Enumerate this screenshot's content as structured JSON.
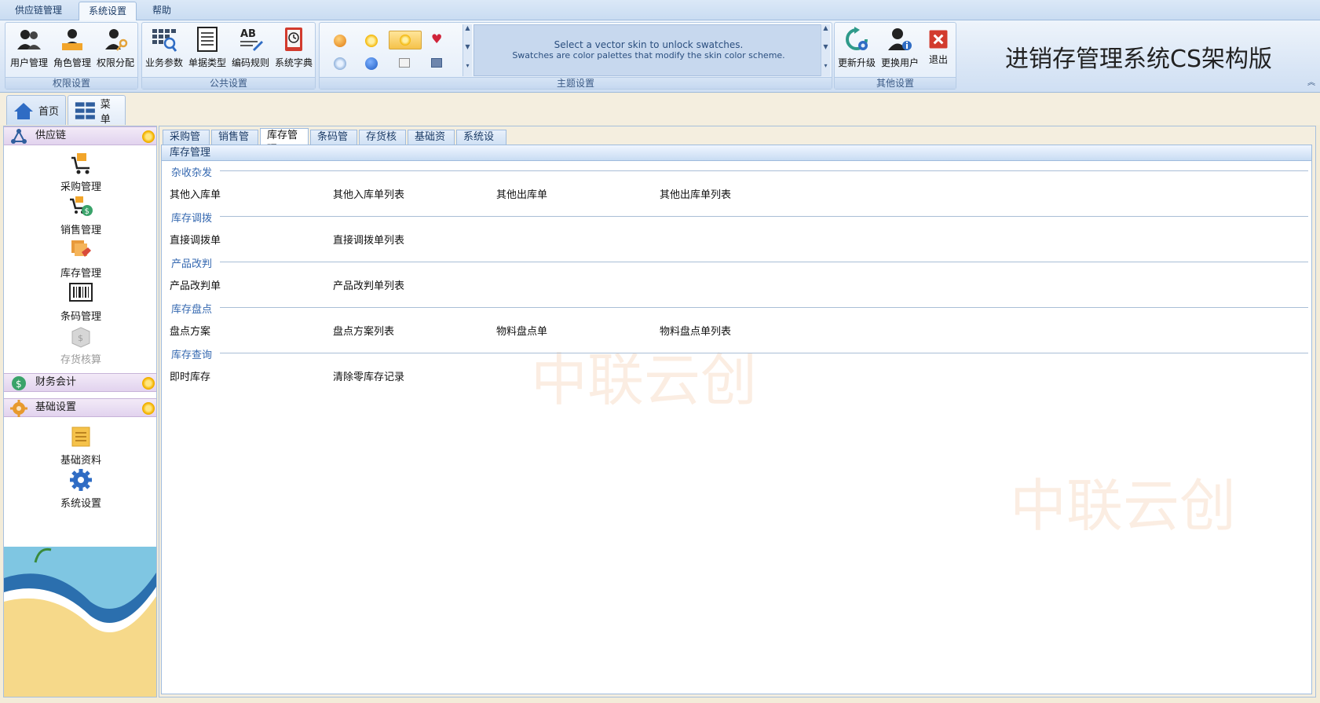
{
  "ribbon_tabs": [
    "供应链管理",
    "系统设置",
    "帮助"
  ],
  "active_ribbon_tab": "系统设置",
  "groups": {
    "permission": {
      "label": "权限设置",
      "buttons": [
        "用户管理",
        "角色管理",
        "权限分配"
      ]
    },
    "public": {
      "label": "公共设置",
      "buttons": [
        "业务参数",
        "单据类型",
        "编码规则",
        "系统字典"
      ]
    },
    "theme": {
      "label": "主题设置",
      "message_line1": "Select a vector skin to unlock swatches.",
      "message_line2": "Swatches are color palettes that modify the skin color scheme."
    },
    "other": {
      "label": "其他设置",
      "buttons": [
        "更新升级",
        "更换用户",
        "退出"
      ]
    }
  },
  "app_title": "进销存管理系统CS架构版",
  "doc_tabs": [
    "首页",
    "菜单"
  ],
  "nav": {
    "sections": [
      {
        "title": "供应链",
        "icon": "network-icon"
      },
      {
        "title": "财务会计",
        "icon": "money-icon"
      },
      {
        "title": "基础设置",
        "icon": "gear-icon"
      }
    ],
    "supply_items": [
      "采购管理",
      "销售管理",
      "库存管理",
      "条码管理",
      "存货核算"
    ],
    "base_items": [
      "基础资料",
      "系统设置"
    ]
  },
  "main_tabs": [
    "采购管理",
    "销售管理",
    "库存管理",
    "条码管理",
    "存货核算",
    "基础资料",
    "系统设置"
  ],
  "active_main_tab": "库存管理",
  "panel": {
    "title": "库存管理",
    "sections": [
      {
        "title": "杂收杂发",
        "items": [
          "其他入库单",
          "其他入库单列表",
          "其他出库单",
          "其他出库单列表"
        ]
      },
      {
        "title": "库存调拨",
        "items": [
          "直接调拨单",
          "直接调拨单列表"
        ]
      },
      {
        "title": "产品改判",
        "items": [
          "产品改判单",
          "产品改判单列表"
        ]
      },
      {
        "title": "库存盘点",
        "items": [
          "盘点方案",
          "盘点方案列表",
          "物料盘点单",
          "物料盘点单列表"
        ]
      },
      {
        "title": "库存查询",
        "items": [
          "即时库存",
          "清除零库存记录"
        ]
      }
    ]
  },
  "watermark_text": "中联云创",
  "colors": {
    "accent": "#3568b0",
    "ribbon": "#dbe7f6",
    "warm_bg": "#f3ecd9"
  }
}
